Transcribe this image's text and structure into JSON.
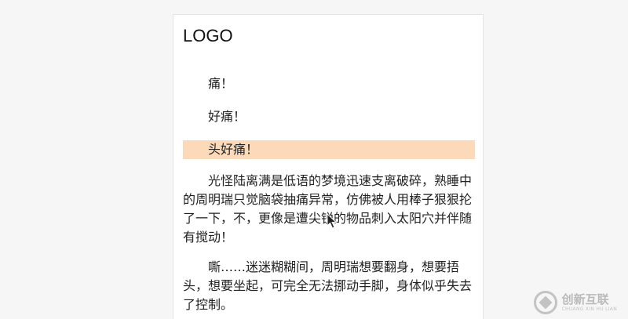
{
  "header": {
    "logo_text": "LOGO"
  },
  "article": {
    "paragraphs": [
      "痛！",
      "好痛！",
      "头好痛！",
      "光怪陆离满是低语的梦境迅速支离破碎，熟睡中的周明瑞只觉脑袋抽痛异常，仿佛被人用棒子狠狠抡了一下，不，更像是遭尖锐的物品刺入太阳穴并伴随有搅动！",
      "嘶……迷迷糊糊间，周明瑞想要翻身，想要捂头，想要坐起，可完全无法挪动手脚，身体似乎失去了控制。"
    ],
    "highlight_color": "#fcd9b8"
  },
  "watermark": {
    "cn": "创新互联",
    "en": "CHUANG XIN HU LIAN"
  }
}
